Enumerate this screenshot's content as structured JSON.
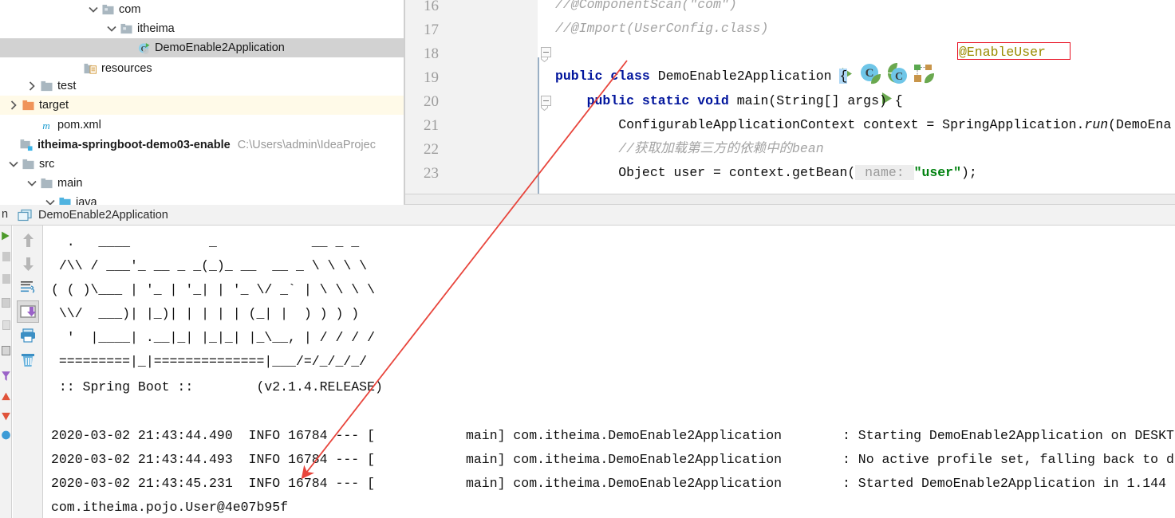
{
  "project_tree": {
    "rows": [
      {
        "label": "com",
        "indent": 110,
        "chevron": "down",
        "icon": "package-folder-icon",
        "state": "normal",
        "name": "tree-item-com"
      },
      {
        "label": "itheima",
        "indent": 133,
        "chevron": "down",
        "icon": "package-folder-icon",
        "state": "normal",
        "name": "tree-item-itheima"
      },
      {
        "label": "DemoEnable2Application",
        "indent": 155,
        "chevron": "none",
        "icon": "java-class-run-icon",
        "state": "selected",
        "name": "tree-item-demoenable2application"
      },
      {
        "label": "resources",
        "indent": 88,
        "chevron": "none",
        "icon": "resources-folder-icon",
        "state": "normal",
        "name": "tree-item-resources"
      },
      {
        "label": "test",
        "indent": 33,
        "chevron": "right",
        "icon": "folder-icon",
        "state": "normal",
        "name": "tree-item-test"
      },
      {
        "label": "target",
        "indent": 10,
        "chevron": "right",
        "icon": "target-folder-icon",
        "state": "highlighted",
        "name": "tree-item-target"
      },
      {
        "label": "pom.xml",
        "indent": 33,
        "chevron": "none",
        "icon": "maven-file-icon",
        "state": "normal",
        "name": "tree-item-pom-xml"
      },
      {
        "label": "itheima-springboot-demo03-enable",
        "indent": 8,
        "chevron": "none",
        "icon": "module-icon",
        "state": "normal",
        "bold": true,
        "path": "C:\\Users\\admin\\IdeaProjec",
        "name": "tree-item-module-root"
      },
      {
        "label": "src",
        "indent": 10,
        "chevron": "down",
        "icon": "folder-icon",
        "state": "normal",
        "name": "tree-item-src"
      },
      {
        "label": "main",
        "indent": 33,
        "chevron": "down",
        "icon": "folder-icon",
        "state": "normal",
        "name": "tree-item-main"
      },
      {
        "label": "java",
        "indent": 56,
        "chevron": "down",
        "icon": "source-folder-icon",
        "state": "normal",
        "name": "tree-item-java"
      }
    ]
  },
  "editor": {
    "line_numbers": [
      "16",
      "17",
      "18",
      "19",
      "20",
      "21",
      "22",
      "23"
    ],
    "annotation": "@EnableUser",
    "lines": [
      {
        "n": "16",
        "segments": [
          {
            "t": "//@ComponentScan(\"com\")",
            "c": "cmt"
          }
        ]
      },
      {
        "n": "17",
        "segments": [
          {
            "t": "//@Import(UserConfig.class)",
            "c": "cmt"
          }
        ]
      },
      {
        "n": "19",
        "segments": [
          {
            "t": "public ",
            "c": "kw"
          },
          {
            "t": "class ",
            "c": "kw"
          },
          {
            "t": "DemoEnable2Application ",
            "c": ""
          },
          {
            "t": "{",
            "c": "brace"
          }
        ]
      },
      {
        "n": "20",
        "segments": [
          {
            "t": "    public static void ",
            "c": "kw"
          },
          {
            "t": "main(String[] args) {",
            "c": ""
          }
        ]
      },
      {
        "n": "21",
        "segments": [
          {
            "t": "        ConfigurableApplicationContext context = SpringApplication.",
            "c": ""
          },
          {
            "t": "run",
            "c": "ital"
          },
          {
            "t": "(DemoEna",
            "c": ""
          }
        ]
      },
      {
        "n": "22",
        "segments": [
          {
            "t": "        //获取加载第三方的依赖中的bean",
            "c": "cmt"
          }
        ]
      },
      {
        "n": "23",
        "segments": [
          {
            "t": "        Object user = context.getBean(",
            "c": ""
          },
          {
            "t": " name: ",
            "c": "hint"
          },
          {
            "t": "\"user\"",
            "c": "str"
          },
          {
            "t": ");",
            "c": ""
          }
        ]
      }
    ],
    "gutter_icons": [
      "run-gutter-icon",
      "spring-bean-icon",
      "spring-config-icon",
      "spring-component-icon",
      "run-method-gutter-icon"
    ]
  },
  "run_panel": {
    "tab_prefix": "n",
    "tab_label": "DemoEnable2Application",
    "tab_icon": "run-configuration-icon",
    "toolbar": [
      {
        "name": "scroll-up-button",
        "icon": "arrow-up-icon",
        "active": false
      },
      {
        "name": "scroll-down-button",
        "icon": "arrow-down-icon",
        "active": false
      },
      {
        "name": "soft-wrap-button",
        "icon": "soft-wrap-icon",
        "active": false
      },
      {
        "name": "scroll-to-end-button",
        "icon": "scroll-to-end-icon",
        "active": true
      },
      {
        "name": "print-button",
        "icon": "printer-icon",
        "active": false
      },
      {
        "name": "clear-all-button",
        "icon": "trash-icon",
        "active": false
      }
    ],
    "banner": "  .   ____          _            __ _ _\n /\\\\ / ___'_ __ _ _(_)_ __  __ _ \\ \\ \\ \\\n( ( )\\___ | '_ | '_| | '_ \\/ _` | \\ \\ \\ \\\n \\\\/  ___)| |_)| | | | | (_| |  ) ) ) )\n  '  |____| .__|_| |_|_| |_\\__, | / / / /\n =========|_|==============|___/=/_/_/_/",
    "banner_version": " :: Spring Boot ::        (v2.1.4.RELEASE)",
    "logs": [
      {
        "left": "2020-03-02 21:43:44.490  INFO 16784 --- [",
        "thread": "main] com.itheima.DemoEnable2Application",
        "msg": ": Starting DemoEnable2Application on DESKT"
      },
      {
        "left": "2020-03-02 21:43:44.493  INFO 16784 --- [",
        "thread": "main] com.itheima.DemoEnable2Application",
        "msg": ": No active profile set, falling back to d"
      },
      {
        "left": "2020-03-02 21:43:45.231  INFO 16784 --- [",
        "thread": "main] com.itheima.DemoEnable2Application",
        "msg": ": Started DemoEnable2Application in 1.144"
      }
    ],
    "output_line": "com.itheima.pojo.User@4e07b95f"
  },
  "annotation_overlay": {
    "arrow_color": "#e8453c",
    "box_color": "#e81123"
  }
}
